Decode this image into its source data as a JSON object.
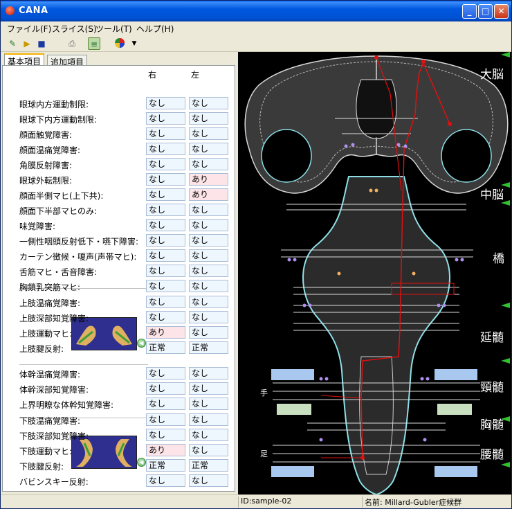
{
  "window": {
    "title": "CANA"
  },
  "menu": {
    "file": "ファイル(F)",
    "slice": "スライス(S)",
    "tools": "ツール(T)",
    "help": "ヘルプ(H)"
  },
  "tabs": [
    {
      "label": "基本項目"
    },
    {
      "label": "追加項目"
    }
  ],
  "columns": {
    "right": "右",
    "left": "左"
  },
  "rows": [
    {
      "label": "眼球内方運動制限:",
      "right": "なし",
      "left": "なし"
    },
    {
      "label": "眼球下内方運動制限:",
      "right": "なし",
      "left": "なし"
    },
    {
      "label": "顔面触覚障害:",
      "right": "なし",
      "left": "なし"
    },
    {
      "label": "顔面温痛覚障害:",
      "right": "なし",
      "left": "なし"
    },
    {
      "label": "角膜反射障害:",
      "right": "なし",
      "left": "なし"
    },
    {
      "label": "眼球外転制限:",
      "right": "なし",
      "left": "あり"
    },
    {
      "label": "顔面半側マヒ(上下共):",
      "right": "なし",
      "left": "あり"
    },
    {
      "label": "顔面下半部マヒのみ:",
      "right": "なし",
      "left": "なし"
    },
    {
      "label": "味覚障害:",
      "right": "なし",
      "left": "なし"
    },
    {
      "label": "一側性咽頭反射低下・嚥下障害:",
      "right": "なし",
      "left": "なし"
    },
    {
      "label": "カーテン徴候・嗄声(声帯マヒ):",
      "right": "なし",
      "left": "なし"
    },
    {
      "label": "舌筋マヒ・舌音障害:",
      "right": "なし",
      "left": "なし"
    },
    {
      "label": "胸鎖乳突筋マヒ:",
      "right": "なし",
      "left": "なし"
    },
    {
      "label": "上肢温痛覚障害:",
      "right": "なし",
      "left": "なし"
    },
    {
      "label": "上肢深部知覚障害:",
      "right": "なし",
      "left": "なし"
    },
    {
      "label": "上肢運動マヒ:",
      "right": "あり",
      "left": "なし"
    },
    {
      "label": "上肢腱反射:",
      "right": "正常",
      "left": "正常"
    },
    {
      "label": "体幹温痛覚障害:",
      "right": "なし",
      "left": "なし"
    },
    {
      "label": "体幹深部知覚障害:",
      "right": "なし",
      "left": "なし"
    },
    {
      "label": "上界明瞭な体幹知覚障害:",
      "right": "なし",
      "left": "なし"
    },
    {
      "label": "下肢温痛覚障害:",
      "right": "なし",
      "left": "なし"
    },
    {
      "label": "下肢深部知覚障害:",
      "right": "なし",
      "left": "なし"
    },
    {
      "label": "下肢運動マヒ:",
      "right": "あり",
      "left": "なし"
    },
    {
      "label": "下肢腱反射:",
      "right": "正常",
      "left": "正常"
    },
    {
      "label": "バビンスキー反射:",
      "right": "なし",
      "left": "なし"
    }
  ],
  "diagram": {
    "regions": {
      "cerebrum": "大脳",
      "midbrain": "中脳",
      "pons": "橋",
      "medulla": "延髄",
      "cervical": "頸髄",
      "thoracic": "胸髄",
      "lumbar": "腰髄"
    },
    "hand": "手",
    "foot": "足"
  },
  "status": {
    "id": "ID:sample-02",
    "name": "名前: Millard-Gubler症候群"
  },
  "colors": {
    "accent": "#0058e0",
    "pink_field": "#fde4e8",
    "blue_field": "#eef6fe",
    "lesion_red": "#e01010",
    "outline_cyan": "#8ee0e8"
  }
}
